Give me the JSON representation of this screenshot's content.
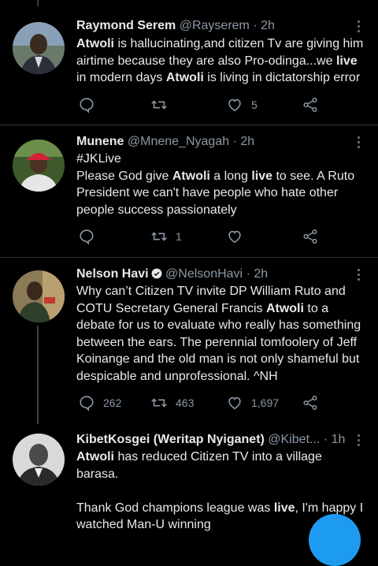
{
  "tweets": [
    {
      "name": "Raymond Serem",
      "handle": "@Rayserem",
      "time": "· 2h",
      "lines": [
        "<b>Atwoli</b> is hallucinating,and citizen Tv are giving him",
        "airtime because they are also Pro-odinga...we <b>live</b>",
        "in modern days <b>Atwoli</b> is living in dictatorship error"
      ],
      "reply_count": "",
      "retweet_count": "",
      "like_count": "5"
    },
    {
      "name": "Munene",
      "handle": "@Mnene_Nyagah",
      "time": "· 2h",
      "lines": [
        "#JKLive",
        "Please God give <b>Atwoli</b> a long <b>live</b> to see. A Ruto",
        "President we can't have people who hate other",
        "people success passionately"
      ],
      "reply_count": "",
      "retweet_count": "1",
      "like_count": ""
    },
    {
      "name": "Nelson Havi",
      "handle": "@NelsonHavi",
      "time": "· 2h",
      "lines": [
        "Why can’t Citizen TV invite DP William Ruto and",
        "COTU Secretary General Francis <b>Atwoli</b> to a",
        "debate for us to evaluate who really has something",
        "between the ears. The perennial tomfoolery of Jeff",
        "Koinange and the old man is not only shameful but",
        "despicable and unprofessional. ^NH"
      ],
      "reply_count": "262",
      "retweet_count": "463",
      "like_count": "1,697"
    },
    {
      "name": "KibetKosgei (Weritap Nyiganet)",
      "handle": "@Kibet...",
      "time": "· 1h",
      "lines": [
        "<b>Atwoli</b> has reduced Citizen TV into a village barasa.",
        "",
        "Thank God champions league was <b>live</b>, I'm happy I",
        "watched Man-U winning"
      ],
      "reply_count": "",
      "retweet_count": "",
      "like_count": ""
    }
  ],
  "icons": {
    "reply": "reply-icon",
    "retweet": "retweet-icon",
    "like": "heart-icon",
    "share": "share-icon",
    "more": "more-options-icon",
    "verified": "verified-badge-icon"
  },
  "colors": {
    "background": "#000000",
    "text": "#e7e9ea",
    "muted": "#8b98a5",
    "divider": "#2f3336",
    "accent": "#1d9bf0"
  }
}
